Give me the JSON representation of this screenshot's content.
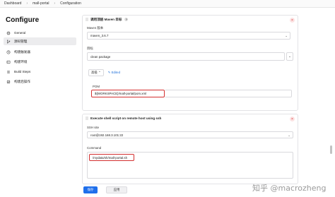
{
  "breadcrumb": {
    "items": [
      "Dashboard",
      "mall-portal",
      "Configuration"
    ],
    "sep": "›"
  },
  "sidebar": {
    "title": "Configure",
    "items": [
      {
        "label": "General",
        "icon": "gear-icon"
      },
      {
        "label": "源码管理",
        "icon": "branch-icon"
      },
      {
        "label": "构建触发器",
        "icon": "trigger-icon"
      },
      {
        "label": "构建环境",
        "icon": "environment-icon"
      },
      {
        "label": "Build Steps",
        "icon": "build-steps-icon"
      },
      {
        "label": "构建后操作",
        "icon": "post-build-icon"
      }
    ]
  },
  "maven_step": {
    "title": "调用顶层 Maven 目标",
    "help": "?",
    "close": "×",
    "version_label": "Maven 版本",
    "version_value": "maven_3.6.7",
    "goals_label": "目标",
    "goals_value": "clean package",
    "advanced_label": "高级",
    "edited_label": "Edited",
    "pom_label": "POM",
    "pom_value": "${WORKSPACE}/mall-portal/pom.xml"
  },
  "ssh_step": {
    "title": "Execute shell script on remote host using ssh",
    "close": "×",
    "site_label": "SSH site",
    "site_value": "root@192.168.3.101:22",
    "command_label": "Command",
    "command_value": "/mydata/sh/mall-portal.sh"
  },
  "footer": {
    "save": "保存",
    "apply": "应用"
  },
  "watermark": "知乎 @macrozheng"
}
